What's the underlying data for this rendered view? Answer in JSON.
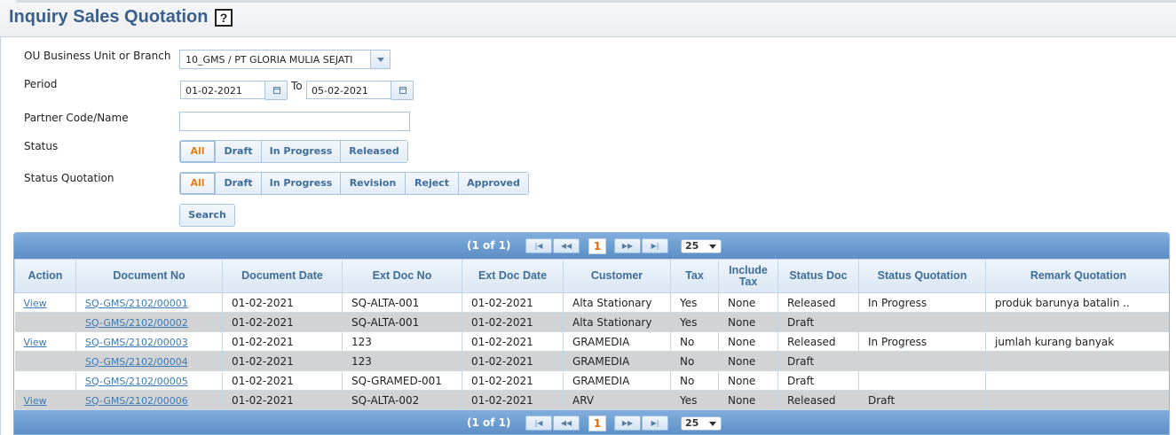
{
  "page": {
    "title": "Inquiry Sales Quotation",
    "help_glyph": "?"
  },
  "form": {
    "ou_label": "OU Business Unit or Branch",
    "ou_value": "10_GMS / PT GLORIA MULIA SEJATI",
    "period_label": "Period",
    "period_from": "01-02-2021",
    "period_to_label": "To",
    "period_to": "05-02-2021",
    "partner_label": "Partner Code/Name",
    "partner_value": "",
    "status_label": "Status",
    "status_options": [
      "All",
      "Draft",
      "In Progress",
      "Released"
    ],
    "status_selected": "All",
    "status_quotation_label": "Status Quotation",
    "status_quotation_options": [
      "All",
      "Draft",
      "In Progress",
      "Revision",
      "Reject",
      "Approved"
    ],
    "status_quotation_selected": "All",
    "search_label": "Search"
  },
  "pager": {
    "info": "(1 of 1)",
    "first": "|◀",
    "prev": "◀◀",
    "current_page": "1",
    "next": "▶▶",
    "last": "▶|",
    "page_size": "25"
  },
  "table": {
    "columns": [
      "Action",
      "Document No",
      "Document Date",
      "Ext Doc No",
      "Ext Doc Date",
      "Customer",
      "Tax",
      "Include Tax",
      "Status Doc",
      "Status Quotation",
      "Remark Quotation"
    ],
    "rows": [
      {
        "action": "View",
        "doc_no": "SQ-GMS/2102/00001",
        "doc_date": "01-02-2021",
        "ext_doc_no": "SQ-ALTA-001",
        "ext_doc_date": "01-02-2021",
        "customer": "Alta Stationary",
        "tax": "Yes",
        "include_tax": "None",
        "status_doc": "Released",
        "status_quotation": "In Progress",
        "remark": "produk barunya batalin .."
      },
      {
        "action": "",
        "doc_no": "SQ-GMS/2102/00002",
        "doc_date": "01-02-2021",
        "ext_doc_no": "SQ-ALTA-001",
        "ext_doc_date": "01-02-2021",
        "customer": "Alta Stationary",
        "tax": "Yes",
        "include_tax": "None",
        "status_doc": "Draft",
        "status_quotation": "",
        "remark": ""
      },
      {
        "action": "View",
        "doc_no": "SQ-GMS/2102/00003",
        "doc_date": "01-02-2021",
        "ext_doc_no": "123",
        "ext_doc_date": "01-02-2021",
        "customer": "GRAMEDIA",
        "tax": "No",
        "include_tax": "None",
        "status_doc": "Released",
        "status_quotation": "In Progress",
        "remark": "jumlah kurang banyak"
      },
      {
        "action": "",
        "doc_no": "SQ-GMS/2102/00004",
        "doc_date": "01-02-2021",
        "ext_doc_no": "123",
        "ext_doc_date": "01-02-2021",
        "customer": "GRAMEDIA",
        "tax": "No",
        "include_tax": "None",
        "status_doc": "Draft",
        "status_quotation": "",
        "remark": ""
      },
      {
        "action": "",
        "doc_no": "SQ-GMS/2102/00005",
        "doc_date": "01-02-2021",
        "ext_doc_no": "SQ-GRAMED-001",
        "ext_doc_date": "01-02-2021",
        "customer": "GRAMEDIA",
        "tax": "No",
        "include_tax": "None",
        "status_doc": "Draft",
        "status_quotation": "",
        "remark": ""
      },
      {
        "action": "View",
        "doc_no": "SQ-GMS/2102/00006",
        "doc_date": "01-02-2021",
        "ext_doc_no": "SQ-ALTA-002",
        "ext_doc_date": "01-02-2021",
        "customer": "ARV",
        "tax": "Yes",
        "include_tax": "None",
        "status_doc": "Released",
        "status_quotation": "Draft",
        "remark": ""
      }
    ]
  },
  "colors": {
    "title": "#3b5f8c",
    "pager_bar": "#5b8ec5",
    "active_tab": "#e67e14",
    "link": "#3b7ab8"
  }
}
